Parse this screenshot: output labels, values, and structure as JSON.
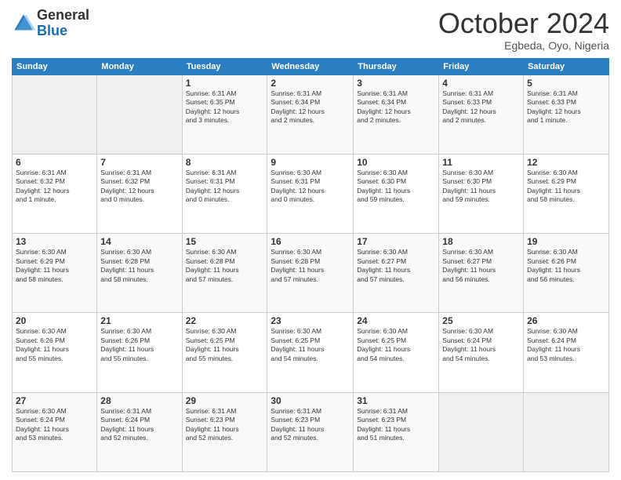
{
  "header": {
    "logo_line1": "General",
    "logo_line2": "Blue",
    "month_title": "October 2024",
    "subtitle": "Egbeda, Oyo, Nigeria"
  },
  "columns": [
    "Sunday",
    "Monday",
    "Tuesday",
    "Wednesday",
    "Thursday",
    "Friday",
    "Saturday"
  ],
  "weeks": [
    [
      {
        "day": "",
        "info": ""
      },
      {
        "day": "",
        "info": ""
      },
      {
        "day": "1",
        "info": "Sunrise: 6:31 AM\nSunset: 6:35 PM\nDaylight: 12 hours\nand 3 minutes."
      },
      {
        "day": "2",
        "info": "Sunrise: 6:31 AM\nSunset: 6:34 PM\nDaylight: 12 hours\nand 2 minutes."
      },
      {
        "day": "3",
        "info": "Sunrise: 6:31 AM\nSunset: 6:34 PM\nDaylight: 12 hours\nand 2 minutes."
      },
      {
        "day": "4",
        "info": "Sunrise: 6:31 AM\nSunset: 6:33 PM\nDaylight: 12 hours\nand 2 minutes."
      },
      {
        "day": "5",
        "info": "Sunrise: 6:31 AM\nSunset: 6:33 PM\nDaylight: 12 hours\nand 1 minute."
      }
    ],
    [
      {
        "day": "6",
        "info": "Sunrise: 6:31 AM\nSunset: 6:32 PM\nDaylight: 12 hours\nand 1 minute."
      },
      {
        "day": "7",
        "info": "Sunrise: 6:31 AM\nSunset: 6:32 PM\nDaylight: 12 hours\nand 0 minutes."
      },
      {
        "day": "8",
        "info": "Sunrise: 6:31 AM\nSunset: 6:31 PM\nDaylight: 12 hours\nand 0 minutes."
      },
      {
        "day": "9",
        "info": "Sunrise: 6:30 AM\nSunset: 6:31 PM\nDaylight: 12 hours\nand 0 minutes."
      },
      {
        "day": "10",
        "info": "Sunrise: 6:30 AM\nSunset: 6:30 PM\nDaylight: 11 hours\nand 59 minutes."
      },
      {
        "day": "11",
        "info": "Sunrise: 6:30 AM\nSunset: 6:30 PM\nDaylight: 11 hours\nand 59 minutes."
      },
      {
        "day": "12",
        "info": "Sunrise: 6:30 AM\nSunset: 6:29 PM\nDaylight: 11 hours\nand 58 minutes."
      }
    ],
    [
      {
        "day": "13",
        "info": "Sunrise: 6:30 AM\nSunset: 6:29 PM\nDaylight: 11 hours\nand 58 minutes."
      },
      {
        "day": "14",
        "info": "Sunrise: 6:30 AM\nSunset: 6:28 PM\nDaylight: 11 hours\nand 58 minutes."
      },
      {
        "day": "15",
        "info": "Sunrise: 6:30 AM\nSunset: 6:28 PM\nDaylight: 11 hours\nand 57 minutes."
      },
      {
        "day": "16",
        "info": "Sunrise: 6:30 AM\nSunset: 6:28 PM\nDaylight: 11 hours\nand 57 minutes."
      },
      {
        "day": "17",
        "info": "Sunrise: 6:30 AM\nSunset: 6:27 PM\nDaylight: 11 hours\nand 57 minutes."
      },
      {
        "day": "18",
        "info": "Sunrise: 6:30 AM\nSunset: 6:27 PM\nDaylight: 11 hours\nand 56 minutes."
      },
      {
        "day": "19",
        "info": "Sunrise: 6:30 AM\nSunset: 6:26 PM\nDaylight: 11 hours\nand 56 minutes."
      }
    ],
    [
      {
        "day": "20",
        "info": "Sunrise: 6:30 AM\nSunset: 6:26 PM\nDaylight: 11 hours\nand 55 minutes."
      },
      {
        "day": "21",
        "info": "Sunrise: 6:30 AM\nSunset: 6:26 PM\nDaylight: 11 hours\nand 55 minutes."
      },
      {
        "day": "22",
        "info": "Sunrise: 6:30 AM\nSunset: 6:25 PM\nDaylight: 11 hours\nand 55 minutes."
      },
      {
        "day": "23",
        "info": "Sunrise: 6:30 AM\nSunset: 6:25 PM\nDaylight: 11 hours\nand 54 minutes."
      },
      {
        "day": "24",
        "info": "Sunrise: 6:30 AM\nSunset: 6:25 PM\nDaylight: 11 hours\nand 54 minutes."
      },
      {
        "day": "25",
        "info": "Sunrise: 6:30 AM\nSunset: 6:24 PM\nDaylight: 11 hours\nand 54 minutes."
      },
      {
        "day": "26",
        "info": "Sunrise: 6:30 AM\nSunset: 6:24 PM\nDaylight: 11 hours\nand 53 minutes."
      }
    ],
    [
      {
        "day": "27",
        "info": "Sunrise: 6:30 AM\nSunset: 6:24 PM\nDaylight: 11 hours\nand 53 minutes."
      },
      {
        "day": "28",
        "info": "Sunrise: 6:31 AM\nSunset: 6:24 PM\nDaylight: 11 hours\nand 52 minutes."
      },
      {
        "day": "29",
        "info": "Sunrise: 6:31 AM\nSunset: 6:23 PM\nDaylight: 11 hours\nand 52 minutes."
      },
      {
        "day": "30",
        "info": "Sunrise: 6:31 AM\nSunset: 6:23 PM\nDaylight: 11 hours\nand 52 minutes."
      },
      {
        "day": "31",
        "info": "Sunrise: 6:31 AM\nSunset: 6:23 PM\nDaylight: 11 hours\nand 51 minutes."
      },
      {
        "day": "",
        "info": ""
      },
      {
        "day": "",
        "info": ""
      }
    ]
  ]
}
